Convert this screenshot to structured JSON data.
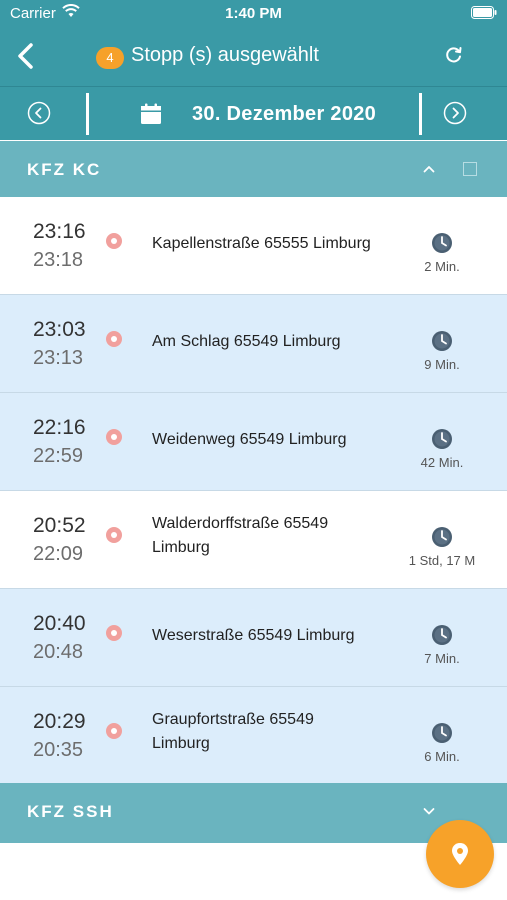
{
  "status_bar": {
    "carrier": "Carrier",
    "time": "1:40 PM"
  },
  "nav": {
    "badge_count": "4",
    "title": "Stopp (s) ausgewählt",
    "icons": {
      "back": "back-chevron-icon",
      "refresh": "refresh-icon"
    }
  },
  "date_bar": {
    "date": "30. Dezember 2020",
    "icons": {
      "prev": "circle-chevron-left-icon",
      "next": "circle-chevron-right-icon",
      "calendar": "calendar-icon"
    }
  },
  "groups": [
    {
      "title": "KFZ KC",
      "expanded": true,
      "checked": false
    },
    {
      "title": "KFZ SSH",
      "expanded": false
    }
  ],
  "stops": [
    {
      "start": "23:16",
      "end": "23:18",
      "address": "Kapellenstraße 65555 Limburg",
      "duration": "2 Min.",
      "background": "white"
    },
    {
      "start": "23:03",
      "end": "23:13",
      "address": "Am Schlag 65549 Limburg",
      "duration": "9 Min.",
      "background": "blue"
    },
    {
      "start": "22:16",
      "end": "22:59",
      "address": "Weidenweg 65549 Limburg",
      "duration": "42 Min.",
      "background": "blue"
    },
    {
      "start": "20:52",
      "end": "22:09",
      "address": "Walderdorffstraße 65549 Limburg",
      "duration": "1 Std, 17 M",
      "background": "white"
    },
    {
      "start": "20:40",
      "end": "20:48",
      "address": "Weserstraße 65549 Limburg",
      "duration": "7 Min.",
      "background": "blue"
    },
    {
      "start": "20:29",
      "end": "20:35",
      "address": "Graupfortstraße 65549 Limburg",
      "duration": "6 Min.",
      "background": "blue"
    }
  ],
  "fab": {
    "icon": "map-pin-icon"
  },
  "colors": {
    "header": "#3a9aa6",
    "group_header": "#6ab4bf",
    "row_blue": "#dcedfb",
    "badge": "#f6a12a",
    "status_dot": "#f1a09d",
    "clock": "#4a5f72"
  }
}
